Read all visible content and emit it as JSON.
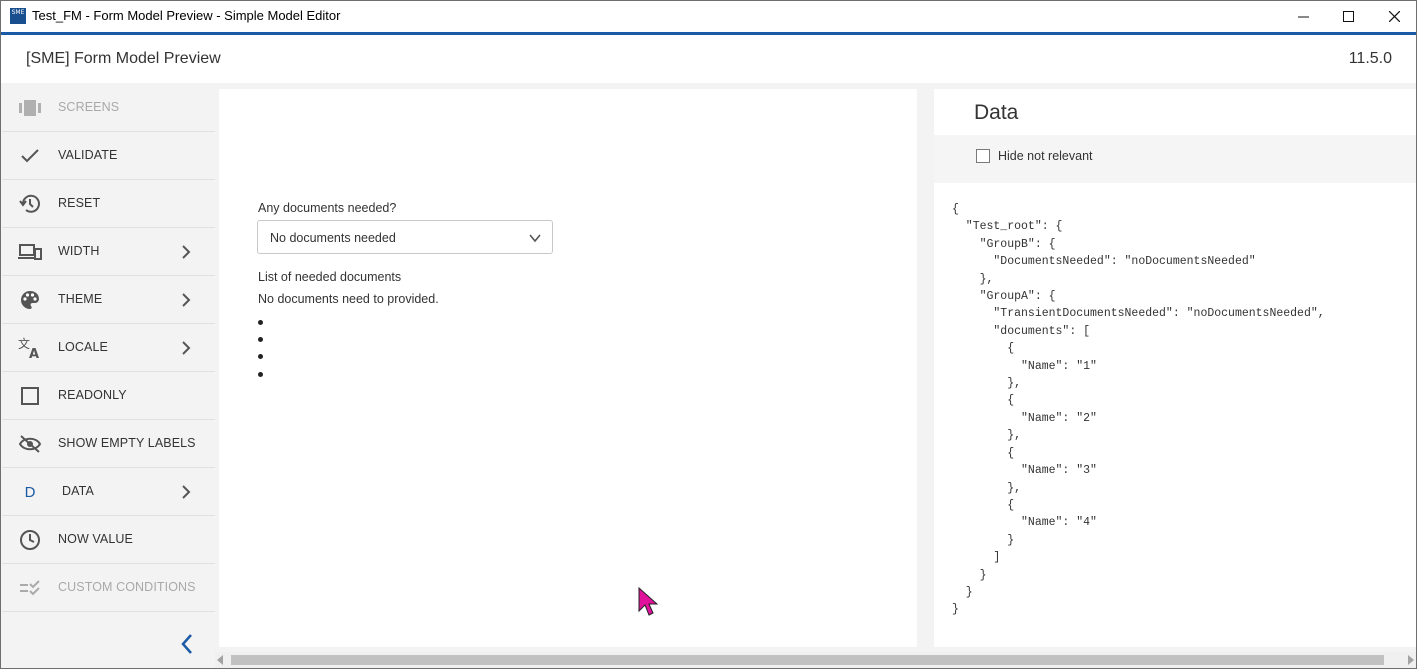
{
  "window": {
    "title": "Test_FM - Form Model Preview - Simple Model Editor",
    "icon_text": "SME",
    "minimize_glyph": "—",
    "maximize_glyph": "☐",
    "close_glyph": "✕"
  },
  "header": {
    "title": "[SME] Form Model Preview",
    "version": "11.5.0"
  },
  "sidebar": {
    "items": [
      {
        "label": "SCREENS",
        "icon": "screens-icon",
        "disabled": true
      },
      {
        "label": "VALIDATE",
        "icon": "check-icon"
      },
      {
        "label": "RESET",
        "icon": "history-icon"
      },
      {
        "label": "WIDTH",
        "icon": "devices-icon",
        "has_submenu": true
      },
      {
        "label": "THEME",
        "icon": "palette-icon",
        "has_submenu": true
      },
      {
        "label": "LOCALE",
        "icon": "translate-icon",
        "has_submenu": true
      },
      {
        "label": "READONLY",
        "icon": "checkbox-icon"
      },
      {
        "label": "SHOW EMPTY LABELS",
        "icon": "eye-off-icon"
      },
      {
        "label": "DATA",
        "icon": "letter-d-icon",
        "icon_text": "D",
        "has_submenu": true
      },
      {
        "label": "NOW VALUE",
        "icon": "clock-icon"
      },
      {
        "label": "CUSTOM CONDITIONS",
        "icon": "rule-icon",
        "disabled": true
      }
    ]
  },
  "preview": {
    "question_label": "Any documents needed?",
    "select_value": "No documents needed",
    "list_label": "List of needed documents",
    "list_note": "No documents need to provided.",
    "bullet_count": 4
  },
  "data_panel": {
    "title": "Data",
    "hide_not_relevant_label": "Hide not relevant",
    "hide_not_relevant_checked": false,
    "json_lines": [
      "{",
      "  \"Test_root\": {",
      "    \"GroupB\": {",
      "      \"DocumentsNeeded\": \"noDocumentsNeeded\"",
      "    },",
      "    \"GroupA\": {",
      "      \"TransientDocumentsNeeded\": \"noDocumentsNeeded\",",
      "      \"documents\": [",
      "        {",
      "          \"Name\": \"1\"",
      "        },",
      "        {",
      "          \"Name\": \"2\"",
      "        },",
      "        {",
      "          \"Name\": \"3\"",
      "        },",
      "        {",
      "          \"Name\": \"4\"",
      "        }",
      "      ]",
      "    }",
      "  }",
      "}"
    ]
  },
  "colors": {
    "accent": "#1b5aa6",
    "cursor": "#e0119a"
  }
}
